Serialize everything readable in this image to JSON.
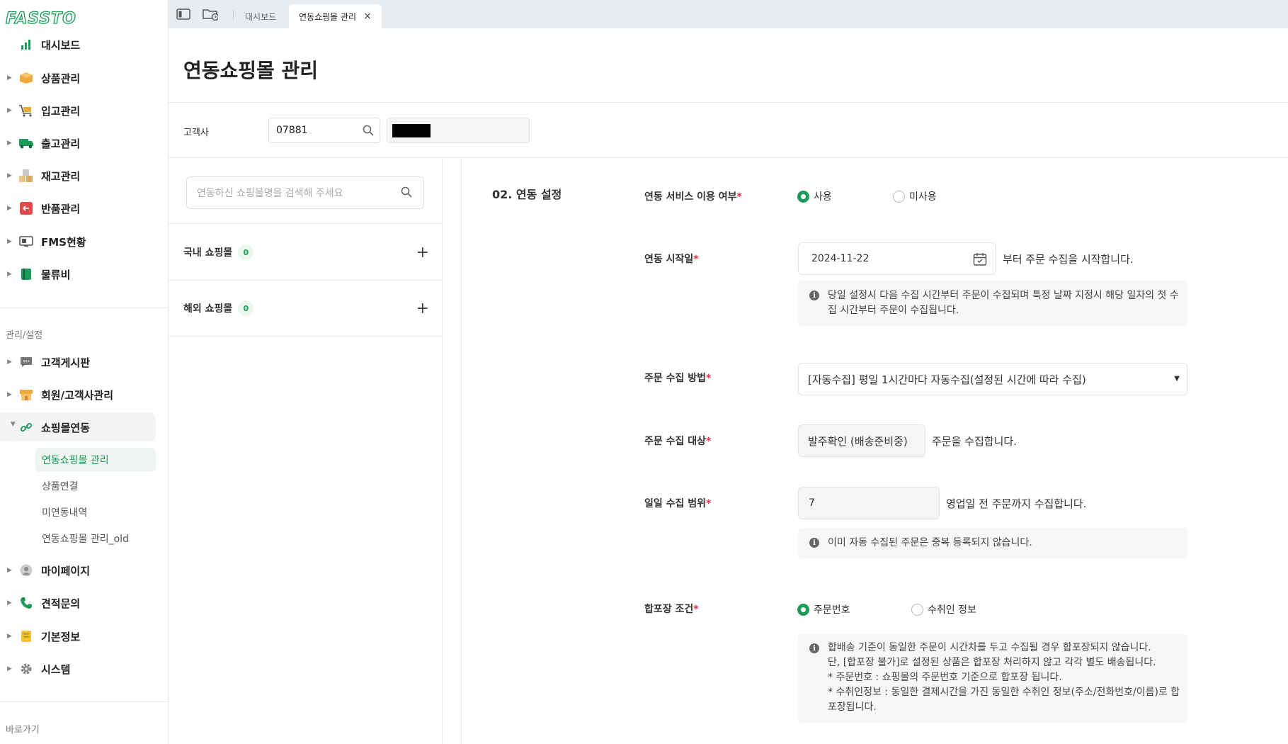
{
  "brand": {
    "logo": "FASSTO",
    "accent": "#1e9a5a"
  },
  "sidebar": {
    "main_items": [
      {
        "label": "대시보드",
        "icon": "bar-chart-icon"
      },
      {
        "label": "상품관리",
        "icon": "box-icon"
      },
      {
        "label": "입고관리",
        "icon": "cart-icon"
      },
      {
        "label": "출고관리",
        "icon": "truck-icon"
      },
      {
        "label": "재고관리",
        "icon": "boxes-icon"
      },
      {
        "label": "반품관리",
        "icon": "return-icon"
      },
      {
        "label": "FMS현황",
        "icon": "monitor-icon"
      },
      {
        "label": "물류비",
        "icon": "ledger-icon"
      }
    ],
    "section_label": "관리/설정",
    "settings_items": [
      {
        "label": "고객게시판",
        "icon": "chat-icon"
      },
      {
        "label": "회원/고객사관리",
        "icon": "store-icon"
      },
      {
        "label": "쇼핑몰연동",
        "icon": "link-icon"
      }
    ],
    "sub_items": [
      "연동쇼핑몰 관리",
      "상품연결",
      "미연동내역",
      "연동쇼핑몰 관리_old"
    ],
    "bottom_items": [
      {
        "label": "마이페이지",
        "icon": "user-icon"
      },
      {
        "label": "견적문의",
        "icon": "phone-icon"
      },
      {
        "label": "기본정보",
        "icon": "note-icon"
      },
      {
        "label": "시스템",
        "icon": "gear-icon"
      }
    ],
    "shortcut_label": "바로가기"
  },
  "topbar": {
    "tabs": [
      {
        "label": "대시보드"
      },
      {
        "label": "연동쇼핑몰 관리"
      }
    ],
    "close": "×"
  },
  "page": {
    "title": "연동쇼핑몰 관리"
  },
  "filter": {
    "customer_label": "고객사",
    "customer_code": "07881"
  },
  "mall_panel": {
    "search_placeholder": "연동하신 쇼핑몰명을 검색해 주세요",
    "groups": [
      {
        "label": "국내 쇼핑몰",
        "count": "0"
      },
      {
        "label": "해외 쇼핑몰",
        "count": "0"
      }
    ],
    "add": "+"
  },
  "settings": {
    "section_title": "02. 연동 설정",
    "use_service": {
      "label": "연동 서비스 이용 여부",
      "options": [
        "사용",
        "미사용"
      ],
      "selected": "사용"
    },
    "start_date": {
      "label": "연동 시작일",
      "value": "2024-11-22",
      "suffix": "부터 주문 수집을 시작합니다.",
      "info": [
        "당일 설정시 다음 수집 시간부터 주문이 수집되며 특정 날짜 지정시 해당 일자의 첫 수",
        "집 시간부터 주문이 수집됩니다."
      ]
    },
    "method": {
      "label": "주문 수집 방법",
      "value": "[자동수집] 평일 1시간마다 자동수집(설정된 시간에 따라 수집)"
    },
    "target": {
      "label": "주문 수집 대상",
      "value": "발주확인 (배송준비중)",
      "suffix": "주문을 수집합니다."
    },
    "range": {
      "label": "일일 수집 범위",
      "value": "7",
      "suffix": "영업일 전 주문까지 수집합니다.",
      "info": [
        "이미 자동 수집된 주문은 중복 등록되지 않습니다."
      ]
    },
    "combine": {
      "label": "합포장 조건",
      "options": [
        "주문번호",
        "수취인 정보"
      ],
      "selected": "주문번호",
      "info": [
        "합배송 기준이 동일한 주문이 시간차를 두고 수집될 경우 합포장되지 않습니다.",
        "단, [합포장 불가]로 설정된 상품은 합포장 처리하지 않고 각각 별도 배송됩니다.",
        "* 주문번호 : 쇼핑몰의 주문번호 기준으로 합포장 됩니다.",
        "* 수취인정보 : 동일한 결제시간을 가진 동일한 수취인 정보(주소/전화번호/이름)로 합",
        "포장됩니다."
      ]
    },
    "required_mark": "*"
  }
}
